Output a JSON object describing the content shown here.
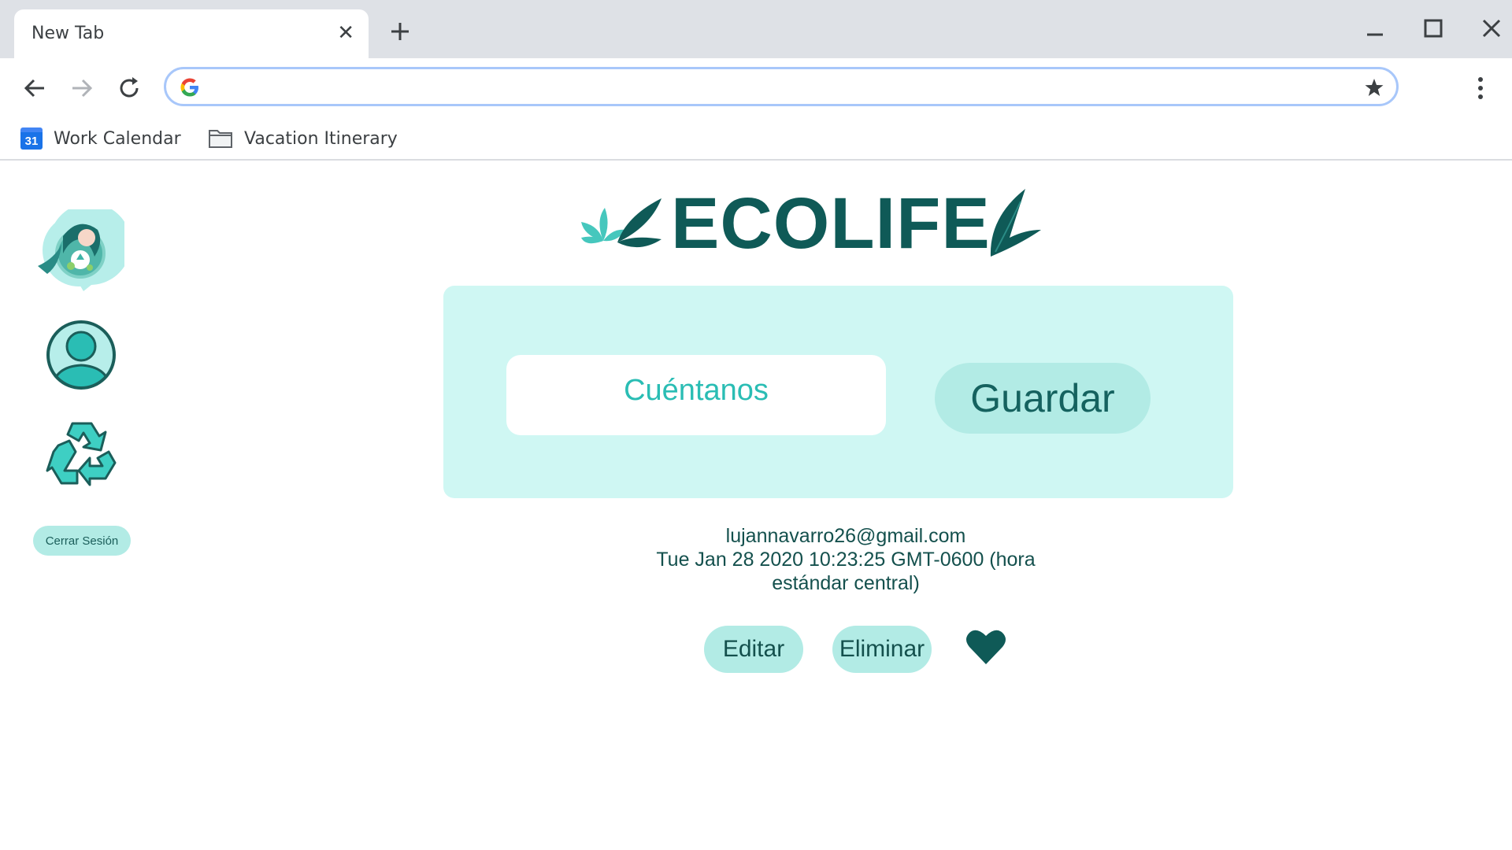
{
  "browser": {
    "tab_title": "New Tab",
    "tab_close_icon": "close-icon",
    "new_tab_icon": "plus-icon",
    "address_value": "",
    "bookmarks": [
      {
        "label": "Work Calendar",
        "icon": "calendar-icon",
        "icon_text": "31"
      },
      {
        "label": "Vacation Itinerary",
        "icon": "folder-icon"
      }
    ]
  },
  "sidebar": {
    "items": [
      {
        "icon": "ecolife-avatar-icon"
      },
      {
        "icon": "user-profile-icon"
      },
      {
        "icon": "recycle-icon"
      }
    ],
    "logout_label": "Cerrar Sesión"
  },
  "brand": {
    "name": "ECOLIFE"
  },
  "composer": {
    "placeholder": "Cuéntanos",
    "save_label": "Guardar"
  },
  "post": {
    "email": "lujannavarro26@gmail.com",
    "timestamp": "Tue Jan 28 2020 10:23:25 GMT-0600 (hora estándar central)",
    "edit_label": "Editar",
    "delete_label": "Eliminar",
    "like_icon": "heart-icon"
  },
  "colors": {
    "brand_dark": "#0f5a57",
    "accent_teal": "#2abdb4",
    "panel_bg": "#cff7f3",
    "button_bg": "#b2ebe5"
  }
}
